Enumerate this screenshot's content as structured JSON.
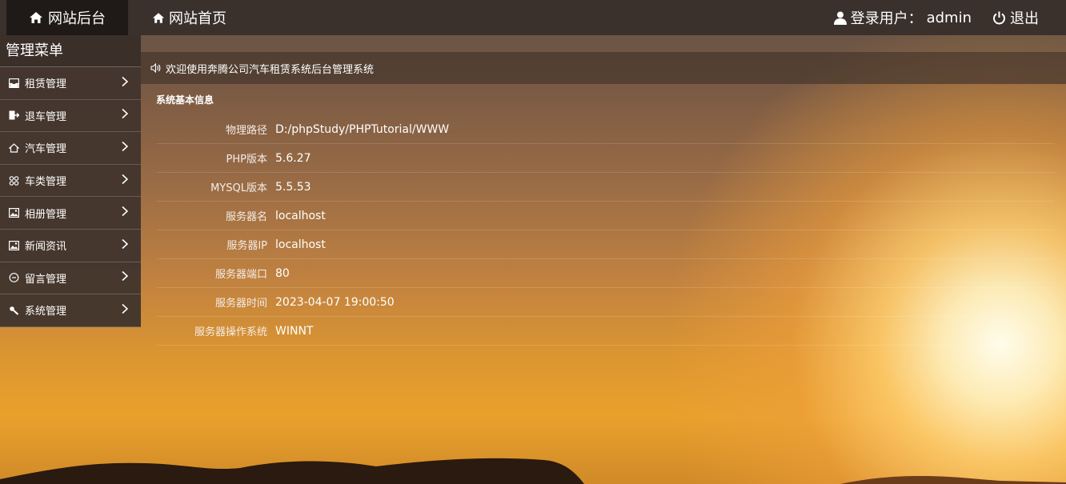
{
  "topbar": {
    "brand": "网站后台",
    "home": "网站首页",
    "user_label": "登录用户：",
    "user_name": "admin",
    "logout": "退出"
  },
  "sidebar": {
    "title": "管理菜单",
    "items": [
      {
        "label": "租赁管理",
        "icon": "inbox-icon"
      },
      {
        "label": "退车管理",
        "icon": "exit-icon"
      },
      {
        "label": "汽车管理",
        "icon": "home-outline-icon"
      },
      {
        "label": "车类管理",
        "icon": "grid-icon"
      },
      {
        "label": "相册管理",
        "icon": "image-icon"
      },
      {
        "label": "新闻资讯",
        "icon": "image-icon"
      },
      {
        "label": "留言管理",
        "icon": "comment-icon"
      },
      {
        "label": "系统管理",
        "icon": "wrench-icon"
      }
    ]
  },
  "welcome": "欢迎使用奔腾公司汽车租赁系统后台管理系统",
  "section_title": "系统基本信息",
  "info": [
    {
      "label": "物理路径",
      "value": "D:/phpStudy/PHPTutorial/WWW"
    },
    {
      "label": "PHP版本",
      "value": "5.6.27"
    },
    {
      "label": "MYSQL版本",
      "value": "5.5.53"
    },
    {
      "label": "服务器名",
      "value": "localhost"
    },
    {
      "label": "服务器IP",
      "value": "localhost"
    },
    {
      "label": "服务器端口",
      "value": "80"
    },
    {
      "label": "服务器时间",
      "value": "2023-04-07 19:00:50"
    },
    {
      "label": "服务器操作系统",
      "value": "WINNT"
    }
  ],
  "colors": {
    "topbar": "#3a302c",
    "brand_bg": "#1f1a18",
    "sun": "#fff6dc"
  }
}
